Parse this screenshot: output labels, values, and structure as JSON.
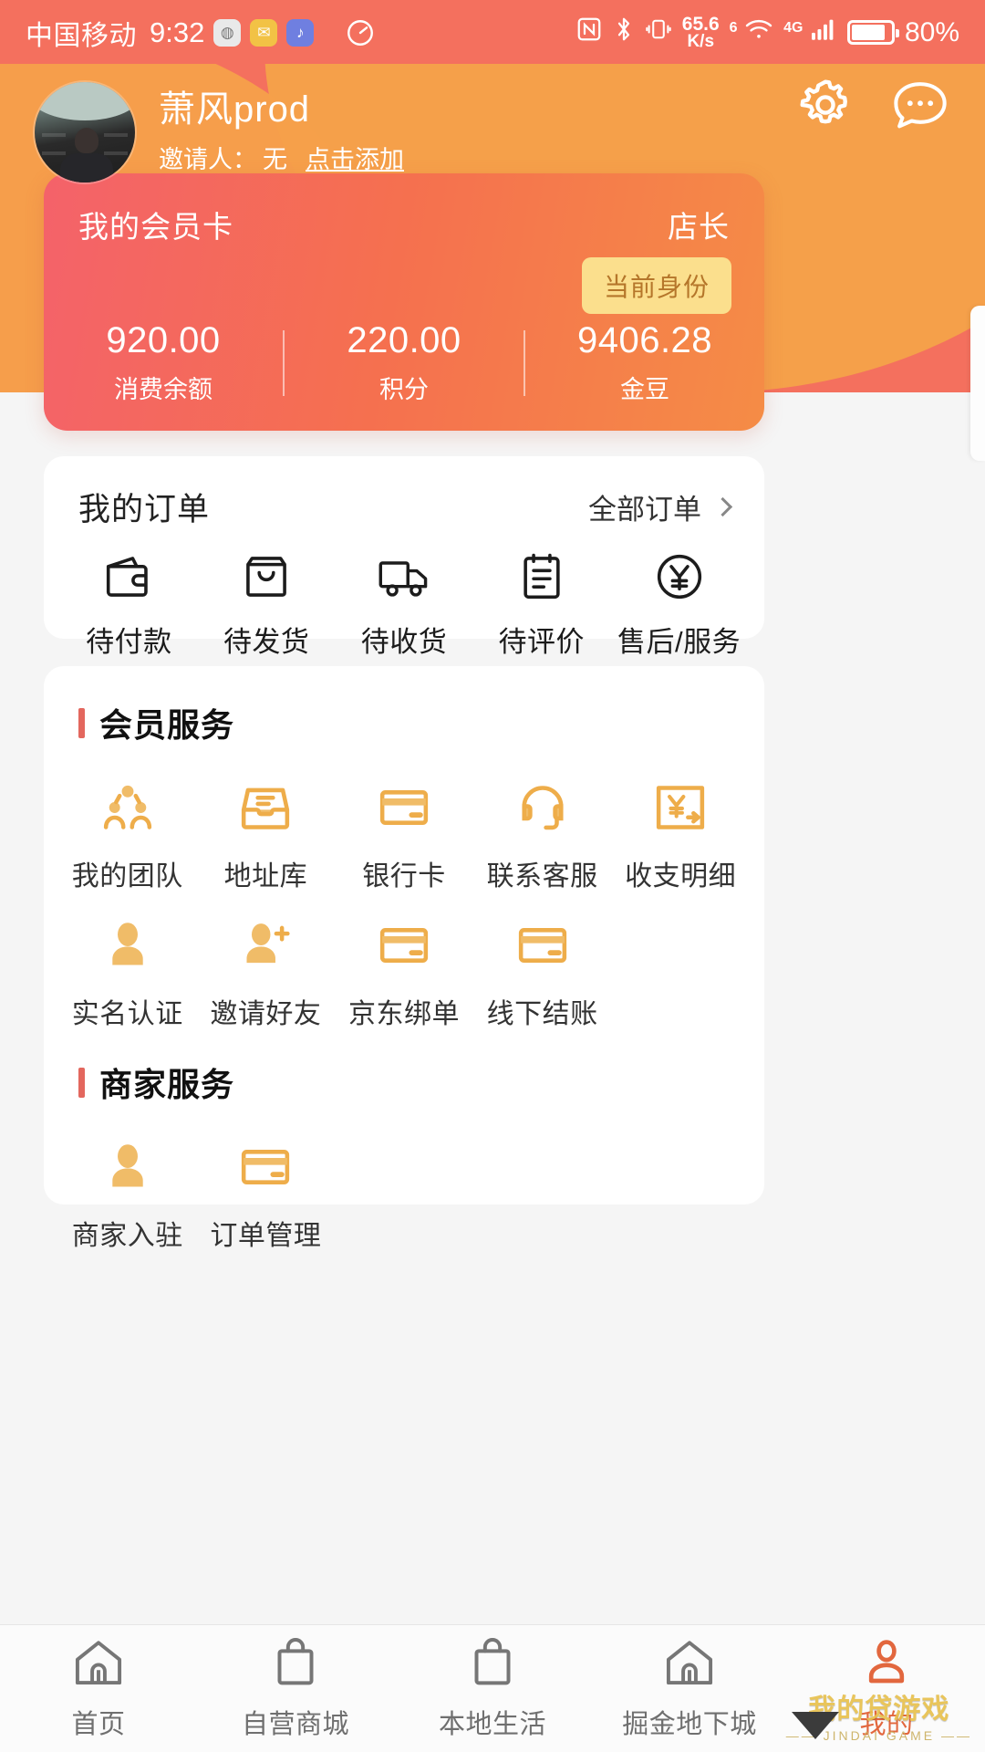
{
  "status_bar": {
    "carrier": "中国移动",
    "time": "9:32",
    "app_icons": [
      "wechat-icon",
      "mail-icon",
      "music-icon"
    ],
    "speedometer_icon": "speedometer-icon",
    "nfc_icon": "nfc-icon",
    "bluetooth_icon": "bluetooth-icon",
    "vibrate_icon": "vibrate-icon",
    "net_speed_value": "65.6",
    "net_speed_unit": "K/s",
    "wifi_sup": "6",
    "signal_sup": "4G",
    "battery_percent": "80%"
  },
  "header": {
    "user_name": "萧风prod",
    "inviter_label": "邀请人：",
    "inviter_value": "无",
    "add_link": "点击添加",
    "settings_icon": "gear-icon",
    "message_icon": "chat-bubble-icon"
  },
  "member_card": {
    "title": "我的会员卡",
    "role": "店长",
    "badge": "当前身份",
    "stats": [
      {
        "value": "920.00",
        "label": "消费余额"
      },
      {
        "value": "220.00",
        "label": "积分"
      },
      {
        "value": "9406.28",
        "label": "金豆"
      }
    ],
    "gradient_from": "#f4626a",
    "gradient_to": "#f58c46"
  },
  "orders": {
    "title": "我的订单",
    "more_label": "全部订单",
    "more_icon": "chevron-right-icon",
    "items": [
      {
        "label": "待付款",
        "icon": "wallet-icon"
      },
      {
        "label": "待发货",
        "icon": "shopping-bag-icon"
      },
      {
        "label": "待收货",
        "icon": "truck-icon"
      },
      {
        "label": "待评价",
        "icon": "clipboard-icon"
      },
      {
        "label": "售后/服务",
        "icon": "yuan-circle-icon"
      }
    ]
  },
  "member_services": {
    "title": "会员服务",
    "accent_color": "#e3675e",
    "items": [
      {
        "label": "我的团队",
        "icon": "group-people-icon"
      },
      {
        "label": "地址库",
        "icon": "address-tray-icon"
      },
      {
        "label": "银行卡",
        "icon": "bank-card-icon"
      },
      {
        "label": "联系客服",
        "icon": "headset-icon"
      },
      {
        "label": "收支明细",
        "icon": "yuan-arrow-icon"
      },
      {
        "label": "实名认证",
        "icon": "person-icon"
      },
      {
        "label": "邀请好友",
        "icon": "person-add-icon"
      },
      {
        "label": "京东绑单",
        "icon": "card-icon"
      },
      {
        "label": "线下结账",
        "icon": "card-icon"
      }
    ]
  },
  "merchant_services": {
    "title": "商家服务",
    "items": [
      {
        "label": "商家入驻",
        "icon": "person-icon"
      },
      {
        "label": "订单管理",
        "icon": "card-icon"
      }
    ]
  },
  "tabbar": {
    "active_color": "#e2673e",
    "items": [
      {
        "label": "首页",
        "icon": "home-icon",
        "active": false
      },
      {
        "label": "自营商城",
        "icon": "shopping-bag-icon",
        "active": false
      },
      {
        "label": "本地生活",
        "icon": "shopping-bag-icon",
        "active": false
      },
      {
        "label": "掘金地下城",
        "icon": "home-icon",
        "active": false
      },
      {
        "label": "我的",
        "icon": "person-icon",
        "active": true
      }
    ]
  },
  "watermark": {
    "title": "我的贷游戏",
    "subtitle": "—— JINDAI GAME ——"
  }
}
